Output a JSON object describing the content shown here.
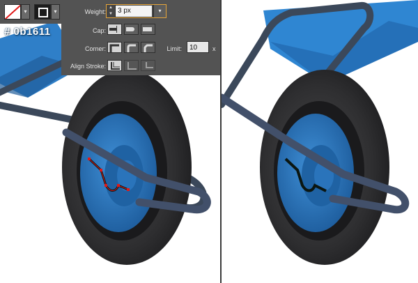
{
  "toolbar": {
    "fill_swatch": "fill-none-swatch",
    "stroke_swatch": "stroke-color-swatch",
    "dropdown_glyph": "▾"
  },
  "color_label": "# 0b1611",
  "stroke_panel": {
    "weight_label": "Weight:",
    "weight_value": "3 px",
    "spinner_up": "▲",
    "spinner_down": "▼",
    "cap_label": "Cap:",
    "corner_label": "Corner:",
    "limit_label": "Limit:",
    "limit_value": "10",
    "limit_unit": "x",
    "align_label": "Align Stroke:",
    "cap_options": [
      "butt-cap",
      "round-cap",
      "projecting-cap"
    ],
    "cap_selected": "butt-cap",
    "corner_options": [
      "miter-join",
      "round-join",
      "bevel-join"
    ],
    "corner_selected": "miter-join",
    "align_options": [
      "align-center",
      "align-inside",
      "align-outside"
    ],
    "align_selected": "align-center"
  },
  "colors": {
    "panel_bg": "#535353",
    "weight_highlight": "#e6a53a",
    "sketch_stroke": "#0b1611",
    "selection_red": "#e01818",
    "wheelbarrow_blue": "#2a78c0",
    "tire": "#2b2b2d",
    "frame": "#3d4a5c"
  }
}
